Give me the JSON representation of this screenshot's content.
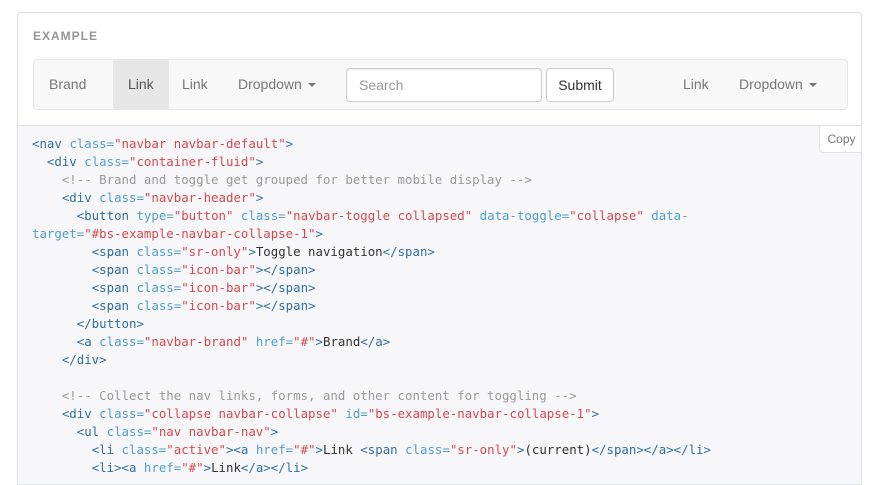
{
  "example": {
    "label": "EXAMPLE"
  },
  "navbar": {
    "brand": "Brand",
    "left_links": [
      {
        "label": "Link",
        "active": true
      },
      {
        "label": "Link",
        "active": false
      },
      {
        "label": "Dropdown",
        "active": false
      }
    ],
    "search": {
      "placeholder": "Search",
      "value": ""
    },
    "submit_label": "Submit",
    "right_links": [
      {
        "label": "Link"
      },
      {
        "label": "Dropdown"
      }
    ]
  },
  "code": {
    "copy_label": "Copy",
    "lines": [
      [
        [
          "tg",
          "<nav "
        ],
        [
          "at",
          "class="
        ],
        [
          "st",
          "\"navbar navbar-default\""
        ],
        [
          "tg",
          ">"
        ]
      ],
      [
        [
          "p",
          "  "
        ],
        [
          "tg",
          "<div "
        ],
        [
          "at",
          "class="
        ],
        [
          "st",
          "\"container-fluid\""
        ],
        [
          "tg",
          ">"
        ]
      ],
      [
        [
          "p",
          "    "
        ],
        [
          "cm",
          "<!-- Brand and toggle get grouped for better mobile display -->"
        ]
      ],
      [
        [
          "p",
          "    "
        ],
        [
          "tg",
          "<div "
        ],
        [
          "at",
          "class="
        ],
        [
          "st",
          "\"navbar-header\""
        ],
        [
          "tg",
          ">"
        ]
      ],
      [
        [
          "p",
          "      "
        ],
        [
          "tg",
          "<button "
        ],
        [
          "at",
          "type="
        ],
        [
          "st",
          "\"button\""
        ],
        [
          "p",
          " "
        ],
        [
          "at",
          "class="
        ],
        [
          "st",
          "\"navbar-toggle collapsed\""
        ],
        [
          "p",
          " "
        ],
        [
          "at",
          "data-toggle="
        ],
        [
          "st",
          "\"collapse\""
        ],
        [
          "p",
          " "
        ],
        [
          "at",
          "data-"
        ]
      ],
      [
        [
          "at",
          "target="
        ],
        [
          "st",
          "\"#bs-example-navbar-collapse-1\""
        ],
        [
          "tg",
          ">"
        ]
      ],
      [
        [
          "p",
          "        "
        ],
        [
          "tg",
          "<span "
        ],
        [
          "at",
          "class="
        ],
        [
          "st",
          "\"sr-only\""
        ],
        [
          "tg",
          ">"
        ],
        [
          "p",
          "Toggle navigation"
        ],
        [
          "tg",
          "</span>"
        ]
      ],
      [
        [
          "p",
          "        "
        ],
        [
          "tg",
          "<span "
        ],
        [
          "at",
          "class="
        ],
        [
          "st",
          "\"icon-bar\""
        ],
        [
          "tg",
          "></span>"
        ]
      ],
      [
        [
          "p",
          "        "
        ],
        [
          "tg",
          "<span "
        ],
        [
          "at",
          "class="
        ],
        [
          "st",
          "\"icon-bar\""
        ],
        [
          "tg",
          "></span>"
        ]
      ],
      [
        [
          "p",
          "        "
        ],
        [
          "tg",
          "<span "
        ],
        [
          "at",
          "class="
        ],
        [
          "st",
          "\"icon-bar\""
        ],
        [
          "tg",
          "></span>"
        ]
      ],
      [
        [
          "p",
          "      "
        ],
        [
          "tg",
          "</button>"
        ]
      ],
      [
        [
          "p",
          "      "
        ],
        [
          "tg",
          "<a "
        ],
        [
          "at",
          "class="
        ],
        [
          "st",
          "\"navbar-brand\""
        ],
        [
          "p",
          " "
        ],
        [
          "at",
          "href="
        ],
        [
          "st",
          "\"#\""
        ],
        [
          "tg",
          ">"
        ],
        [
          "p",
          "Brand"
        ],
        [
          "tg",
          "</a>"
        ]
      ],
      [
        [
          "p",
          "    "
        ],
        [
          "tg",
          "</div>"
        ]
      ],
      [
        [
          "p",
          ""
        ]
      ],
      [
        [
          "p",
          "    "
        ],
        [
          "cm",
          "<!-- Collect the nav links, forms, and other content for toggling -->"
        ]
      ],
      [
        [
          "p",
          "    "
        ],
        [
          "tg",
          "<div "
        ],
        [
          "at",
          "class="
        ],
        [
          "st",
          "\"collapse navbar-collapse\""
        ],
        [
          "p",
          " "
        ],
        [
          "at",
          "id="
        ],
        [
          "st",
          "\"bs-example-navbar-collapse-1\""
        ],
        [
          "tg",
          ">"
        ]
      ],
      [
        [
          "p",
          "      "
        ],
        [
          "tg",
          "<ul "
        ],
        [
          "at",
          "class="
        ],
        [
          "st",
          "\"nav navbar-nav\""
        ],
        [
          "tg",
          ">"
        ]
      ],
      [
        [
          "p",
          "        "
        ],
        [
          "tg",
          "<li "
        ],
        [
          "at",
          "class="
        ],
        [
          "st",
          "\"active\""
        ],
        [
          "tg",
          "><a "
        ],
        [
          "at",
          "href="
        ],
        [
          "st",
          "\"#\""
        ],
        [
          "tg",
          ">"
        ],
        [
          "p",
          "Link "
        ],
        [
          "tg",
          "<span "
        ],
        [
          "at",
          "class="
        ],
        [
          "st",
          "\"sr-only\""
        ],
        [
          "tg",
          ">"
        ],
        [
          "p",
          "(current)"
        ],
        [
          "tg",
          "</span></a></li>"
        ]
      ],
      [
        [
          "p",
          "        "
        ],
        [
          "tg",
          "<li><a "
        ],
        [
          "at",
          "href="
        ],
        [
          "st",
          "\"#\""
        ],
        [
          "tg",
          ">"
        ],
        [
          "p",
          "Link"
        ],
        [
          "tg",
          "</a></li>"
        ]
      ]
    ]
  }
}
